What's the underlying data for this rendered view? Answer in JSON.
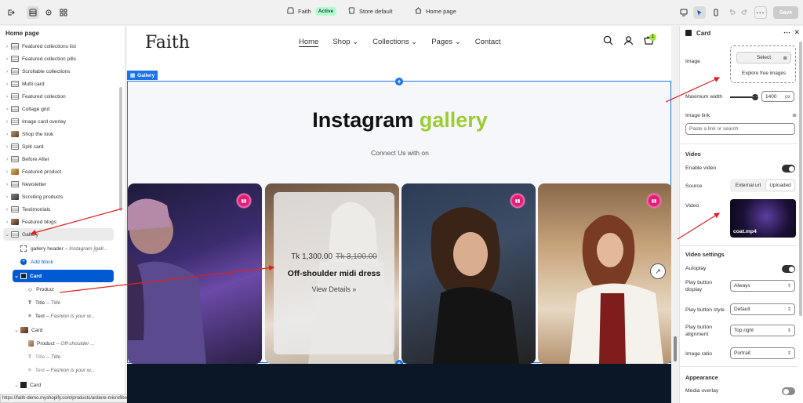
{
  "topbar": {
    "store_name": "Faith",
    "status_badge": "Active",
    "store_default": "Store default",
    "page_name": "Home page",
    "save_label": "Save"
  },
  "sidebar": {
    "title": "Home page",
    "sections": [
      {
        "label": "Featured collections list",
        "icon": "section-icon"
      },
      {
        "label": "Featured collection pills",
        "icon": "section-icon"
      },
      {
        "label": "Scrollable collections",
        "icon": "section-icon"
      },
      {
        "label": "Multi card",
        "icon": "section-icon"
      },
      {
        "label": "Featured collection",
        "icon": "section-icon"
      },
      {
        "label": "Collage grid",
        "icon": "section-icon"
      },
      {
        "label": "Image card overlay",
        "icon": "section-icon"
      },
      {
        "label": "Shop the look",
        "icon": "image-icon"
      },
      {
        "label": "Split card",
        "icon": "section-icon"
      },
      {
        "label": "Before After",
        "icon": "section-icon"
      },
      {
        "label": "Featured product",
        "icon": "image-icon"
      },
      {
        "label": "Newsletter",
        "icon": "section-icon"
      },
      {
        "label": "Scrolling products",
        "icon": "image-icon"
      },
      {
        "label": "Testimonials",
        "icon": "section-icon"
      },
      {
        "label": "Featured blogs",
        "icon": "image-icon"
      }
    ],
    "gallery_label": "Gallery",
    "gallery_header": "gallery header",
    "gallery_header_sub": "– Instagram [gall...",
    "add_block": "Add block",
    "card_label": "Card",
    "product_label": "Product",
    "title_label": "Title",
    "title_sub": "– Title",
    "text_label": "Text",
    "text_sub": "– Fashion is your w...",
    "card2_label": "Card",
    "product2_label": "Product",
    "product2_sub": "– Off-shoulder ...",
    "title2_label": "Title",
    "title2_sub": "– Title",
    "text2_label": "Text",
    "text2_sub": "– Fashion is your w...",
    "card3_label": "Card"
  },
  "status_url": "https://faith-demo.myshopify.com/products/ardene-microfiber-tights",
  "site": {
    "logo": "Faith",
    "nav": [
      "Home",
      "Shop",
      "Collections",
      "Pages",
      "Contact"
    ],
    "cart_count": "1"
  },
  "gallery": {
    "tag": "Gallery",
    "title_main": "Instagram",
    "title_accent": "gallery",
    "subtitle": "Connect Us with on",
    "overlay": {
      "price": "Tk 1,300.00",
      "compare_price": "Tk 3,100.00",
      "name": "Off-shoulder midi dress",
      "view": "View Details"
    }
  },
  "panel": {
    "title": "Card",
    "image_label": "Image",
    "select_btn": "Select",
    "explore": "Explore free images",
    "max_width_label": "Maximum width",
    "max_width_value": "1400",
    "max_width_unit": "px",
    "max_width_fraction": 0.75,
    "image_link_label": "Image link",
    "image_link_placeholder": "Paste a link or search",
    "video_heading": "Video",
    "enable_video": "Enable video",
    "enable_video_on": true,
    "source_label": "Source",
    "source_options": [
      "External url",
      "Uploaded"
    ],
    "source_selected": "Uploaded",
    "video_label": "Video",
    "video_file": "coat.mp4",
    "video_settings_heading": "Video settings",
    "autoplay": "Autoplay",
    "autoplay_on": true,
    "play_display_label": "Play button display",
    "play_display_value": "Always",
    "play_style_label": "Play button style",
    "play_style_value": "Default",
    "play_align_label": "Play button alignment",
    "play_align_value": "Top right",
    "ratio_label": "Image ratio",
    "ratio_value": "Portrait",
    "appearance_heading": "Appearance",
    "media_overlay": "Media overlay",
    "media_overlay_on": false
  },
  "colors": {
    "accent_blue": "#005bd3",
    "selection_blue": "#1a73e8",
    "gallery_accent": "#9ccc33",
    "active_badge": "#b4fed2",
    "annotation_red": "#e02020"
  }
}
